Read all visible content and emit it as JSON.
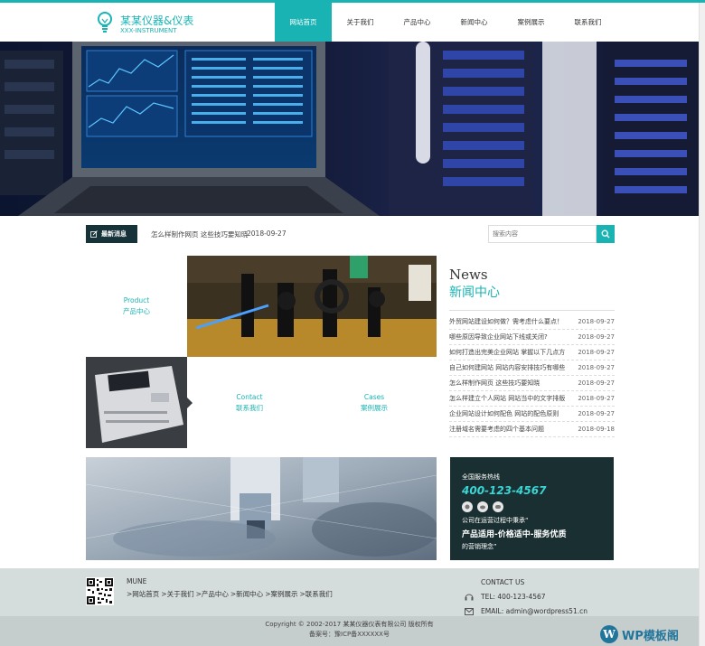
{
  "colors": {
    "accent": "#1ab3b3",
    "dark": "#17333a"
  },
  "logo": {
    "cn": "某某仪器&仪表",
    "en": "XXX-INSTRUMENT"
  },
  "nav": [
    "网站首页",
    "关于我们",
    "产品中心",
    "新闻中心",
    "案例展示",
    "联系我们"
  ],
  "ticker": {
    "tag": "最新消息",
    "headline": "怎么样制作网页 这些技巧要知晓",
    "date": "2018-09-27"
  },
  "search": {
    "placeholder": "搜索内容"
  },
  "tiles": {
    "product": {
      "en": "Product",
      "cn": "产品中心"
    },
    "contact": {
      "en": "Contact",
      "cn": "联系我们"
    },
    "cases": {
      "en": "Cases",
      "cn": "案例展示"
    }
  },
  "news": {
    "title_en": "News",
    "title_cn": "新闻中心",
    "items": [
      {
        "title": "外贸网站建设如何做？需考虑什么要点！",
        "date": "2018-09-27"
      },
      {
        "title": "哪些原因导致企业网站下线或关闭?",
        "date": "2018-09-27"
      },
      {
        "title": "如何打造出完美企业网站 掌握以下几点方",
        "date": "2018-09-27"
      },
      {
        "title": "自己如何建网站 网站内容安排技巧有哪些",
        "date": "2018-09-27"
      },
      {
        "title": "怎么样制作网页 这些技巧要知晓",
        "date": "2018-09-27"
      },
      {
        "title": "怎么样建立个人网站 网站当中的文字排版",
        "date": "2018-09-27"
      },
      {
        "title": "企业网站设计如何配色 网站的配色原则",
        "date": "2018-09-27"
      },
      {
        "title": "注册域名需要考虑的四个基本问题",
        "date": "2018-09-18"
      }
    ]
  },
  "hotline": {
    "label": "全国服务热线",
    "phone": "400-123-4567",
    "line1": "公司在运营过程中秉承“",
    "line2": "产品适用-价格适中-服务优质",
    "line3": "的营销理念”"
  },
  "footer": {
    "mune": "MUNE",
    "links": [
      ">网站首页",
      ">关于我们",
      ">产品中心",
      ">新闻中心",
      ">案例展示",
      ">联系我们"
    ],
    "contact_title": "CONTACT US",
    "tel": "TEL:  400-123-4567",
    "email": "EMAIL:  admin@wordpress51.cn"
  },
  "copyright": {
    "line1": "Copyright © 2002-2017 某某仪器仪表有限公司 版权所有",
    "line2": "备案号：豫ICP备XXXXXX号"
  },
  "watermark": {
    "text": "WP模板阁",
    "mark": "W"
  }
}
